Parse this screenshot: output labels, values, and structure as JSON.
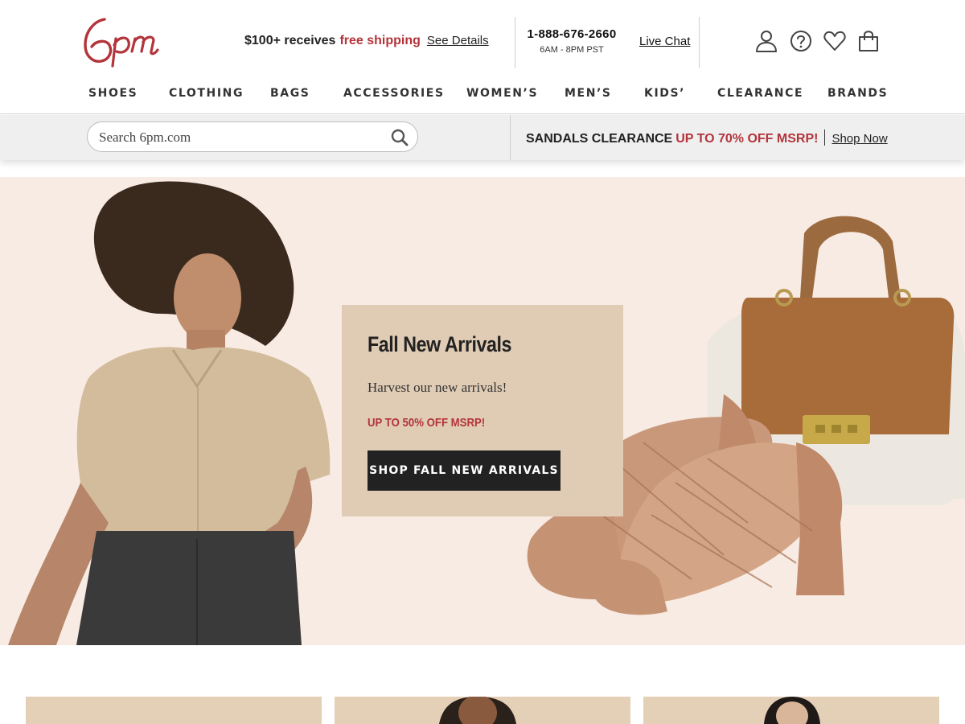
{
  "brand": {
    "logo_text": "6pm",
    "logo_color": "#b3343a"
  },
  "header": {
    "shipping_amount": "$100+ receives",
    "shipping_free": "free shipping",
    "see_details": "See Details",
    "phone": "1-888-676-2660",
    "hours": "6AM - 8PM PST",
    "live_chat": "Live Chat",
    "icons": [
      "account-icon",
      "help-icon",
      "favorites-icon",
      "bag-icon"
    ]
  },
  "nav": {
    "items": [
      "SHOES",
      "CLOTHING",
      "BAGS",
      "ACCESSORIES",
      "WOMEN’S",
      "MEN’S",
      "KIDS’",
      "CLEARANCE",
      "BRANDS"
    ]
  },
  "search": {
    "placeholder": "Search 6pm.com"
  },
  "promo": {
    "lead": "SANDALS CLEARANCE",
    "highlight": "UP TO 70% OFF MSRP!",
    "link": "Shop Now"
  },
  "hero": {
    "title": "Fall New Arrivals",
    "subtitle": "Harvest our new arrivals!",
    "discount": "UP TO 50% OFF MSRP!",
    "cta": "SHOP FALL NEW ARRIVALS",
    "background": "#f8ebe3",
    "card_color": "#e0cbb4"
  },
  "colors": {
    "accent": "#b3343a",
    "dark": "#222222"
  }
}
